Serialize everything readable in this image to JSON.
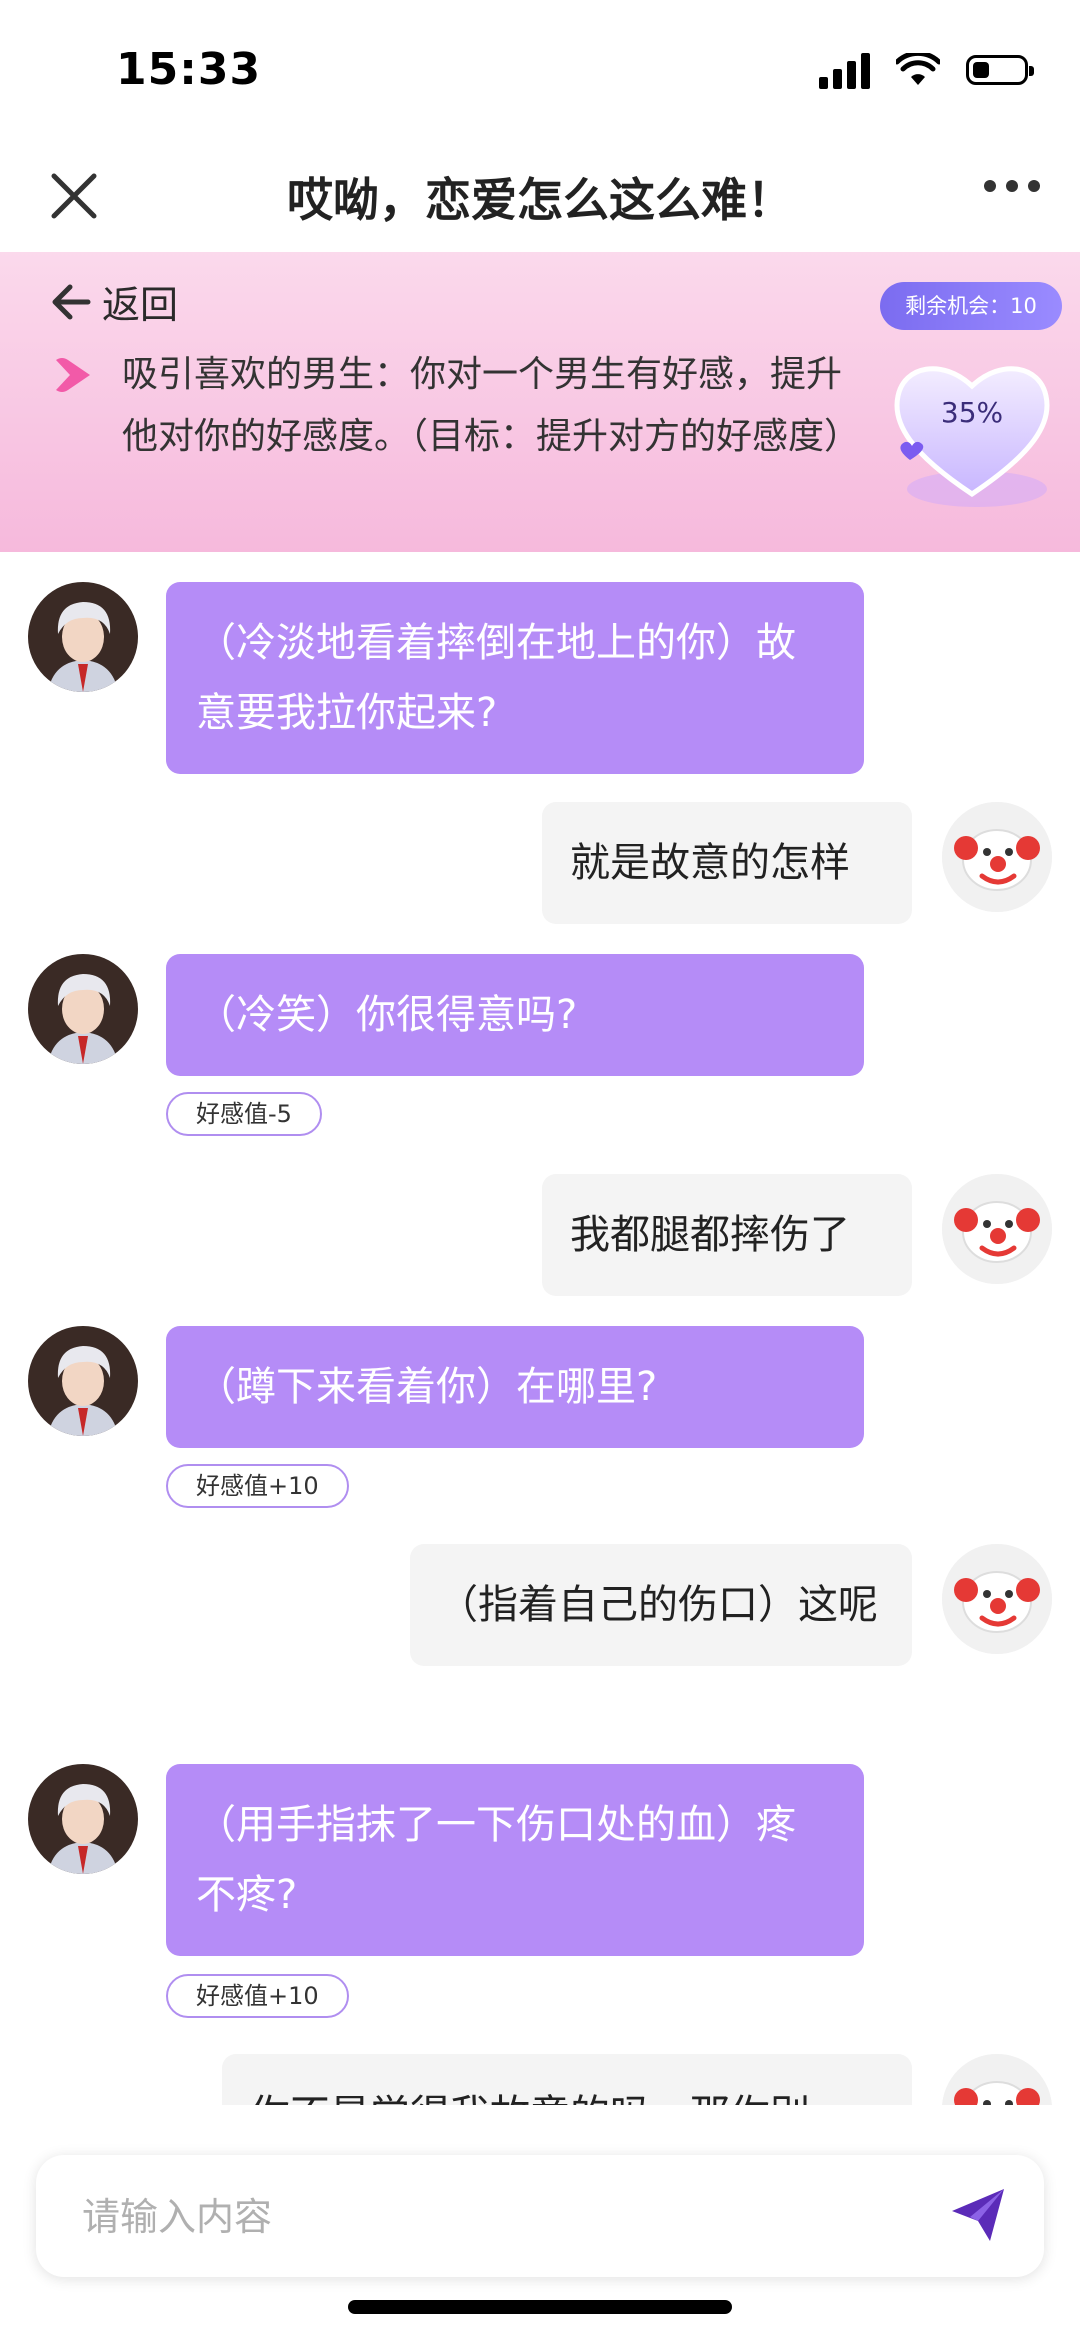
{
  "status_bar": {
    "time": "15:33"
  },
  "nav": {
    "title": "哎呦，恋爱怎么这么难！"
  },
  "banner": {
    "back_label": "返回",
    "mission": "吸引喜欢的男生：你对一个男生有好感，提升他对你的好感度。（目标：提升对方的好感度）",
    "chances_label": "剩余机会：10",
    "affinity_percent": "35%"
  },
  "messages": [
    {
      "from": "npc",
      "text": "（冷淡地看着摔倒在地上的你）故意要我拉你起来?"
    },
    {
      "from": "user",
      "text": "就是故意的怎样"
    },
    {
      "from": "npc",
      "text": "（冷笑）你很得意吗?",
      "affinity": "好感值-5"
    },
    {
      "from": "user",
      "text": "我都腿都摔伤了"
    },
    {
      "from": "npc",
      "text": "（蹲下来看着你）在哪里?",
      "affinity": "好感值+10"
    },
    {
      "from": "user",
      "text": "（指着自己的伤口）这呢"
    },
    {
      "from": "npc",
      "text": "（用手指抹了一下伤口处的血）疼不疼?",
      "affinity": "好感值+10"
    },
    {
      "from": "user",
      "text": "你不是觉得我故意的吗，那你别"
    }
  ],
  "input": {
    "placeholder": "请输入内容"
  },
  "colors": {
    "npc_bubble": "#b58cf7",
    "user_bubble": "#f4f4f4",
    "banner_pink": "#f8c6e2",
    "accent": "#7b5cf0"
  },
  "icons": {
    "close": "close-icon",
    "more": "more-icon",
    "back": "back-arrow-icon",
    "send": "send-icon",
    "heart": "heart-icon"
  }
}
